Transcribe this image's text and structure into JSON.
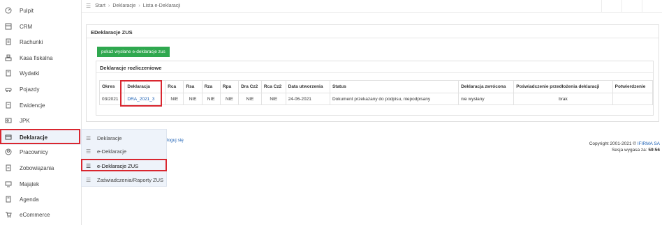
{
  "sidebar": {
    "items": [
      {
        "label": "Pulpit",
        "icon": "dashboard-icon"
      },
      {
        "label": "CRM",
        "icon": "crm-icon"
      },
      {
        "label": "Rachunki",
        "icon": "invoice-icon"
      },
      {
        "label": "Kasa fiskalna",
        "icon": "cash-register-icon"
      },
      {
        "label": "Wydatki",
        "icon": "expenses-icon"
      },
      {
        "label": "Pojazdy",
        "icon": "car-icon"
      },
      {
        "label": "Ewidencje",
        "icon": "records-icon"
      },
      {
        "label": "JPK",
        "icon": "jpk-icon"
      },
      {
        "label": "Deklaracje",
        "icon": "declarations-icon"
      },
      {
        "label": "Pracownicy",
        "icon": "employees-icon"
      },
      {
        "label": "Zobowiązania",
        "icon": "liabilities-icon"
      },
      {
        "label": "Majątek",
        "icon": "assets-icon"
      },
      {
        "label": "Agenda",
        "icon": "agenda-icon"
      },
      {
        "label": "eCommerce",
        "icon": "cart-icon"
      }
    ]
  },
  "breadcrumb": {
    "start": "Start",
    "section": "Deklaracje",
    "current": "Lista e-Deklaracji"
  },
  "panel": {
    "title": "EDeklaracje ZUS",
    "button": "pokaż wysłane e-deklaracje zus",
    "inner_title": "Deklaracje rozliczeniowe"
  },
  "table": {
    "headers": [
      "Okres",
      "Deklaracja",
      "Rca",
      "Rsa",
      "Rza",
      "Rpa",
      "Dra Cz2",
      "Rca Cz2",
      "Data utworzenia",
      "Status",
      "Deklaracja zwrócona",
      "Poświadczenie przedłożenia deklaracji",
      "Potwierdzenie"
    ],
    "rows": [
      [
        "03/2021",
        "DRA_2021_3",
        "NIE",
        "NIE",
        "NIE",
        "NIE",
        "NIE",
        "NIE",
        "24-06-2021",
        "Dokument przekazany do podpisu, niepodpisany",
        "nie wysłany",
        "brak",
        ""
      ]
    ]
  },
  "submenu": {
    "items": [
      "Deklaracje",
      "e-Deklaracje",
      "e-Deklaracje ZUS",
      "Zaświadczenia/Raporty ZUS"
    ]
  },
  "logout": "loguj się",
  "footer": {
    "copyright": "Copyright 2001-2021 ©",
    "brand": "IFIRMA SA",
    "session_label": "Sesja wygasa za:",
    "session_time": "59:56"
  },
  "colors": {
    "accent_green": "#2fa84f",
    "highlight_red": "#d9262f",
    "link_blue": "#1a5fb4"
  }
}
